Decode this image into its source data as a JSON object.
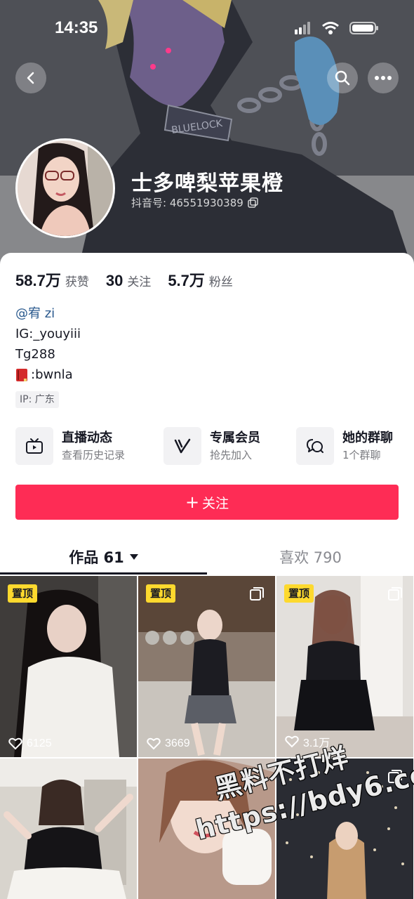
{
  "status_bar": {
    "time": "14:35"
  },
  "profile": {
    "nickname": "士多啤梨苹果橙",
    "douyin_id_label": "抖音号: 46551930389",
    "stats": [
      {
        "num": "58.7万",
        "label": "获赞"
      },
      {
        "num": "30",
        "label": "关注"
      },
      {
        "num": "5.7万",
        "label": "粉丝"
      }
    ],
    "bio": {
      "mention": "@宥 zi",
      "line2": "IG:_youyiii",
      "line3": "Tg288",
      "line4": ":bwnla"
    },
    "ip": "IP:  广东"
  },
  "features": [
    {
      "title": "直播动态",
      "sub": "查看历史记录",
      "icon": "tv-icon"
    },
    {
      "title": "专属会员",
      "sub": "抢先加入",
      "icon": "vip-v-icon"
    },
    {
      "title": "她的群聊",
      "sub": "1个群聊",
      "icon": "chat-bubbles-icon"
    }
  ],
  "follow_button": {
    "plus": "+",
    "label": "关注"
  },
  "tabs": {
    "works": "作品 61",
    "likes": "喜欢 790"
  },
  "grid": [
    {
      "pinned": "置顶",
      "likes": "6125"
    },
    {
      "pinned": "置顶",
      "likes": "3669"
    },
    {
      "pinned": "置顶",
      "likes": "3.1万"
    },
    {
      "pinned": "",
      "likes": ""
    },
    {
      "pinned": "",
      "likes": ""
    },
    {
      "pinned": "",
      "likes": ""
    }
  ],
  "watermark": {
    "line1": "黑料不打烊",
    "line2": "https://bdy6.co"
  },
  "colors": {
    "accent": "#fe2c55",
    "pin_badge": "#fdd92e",
    "mention": "#2b5a8e"
  }
}
